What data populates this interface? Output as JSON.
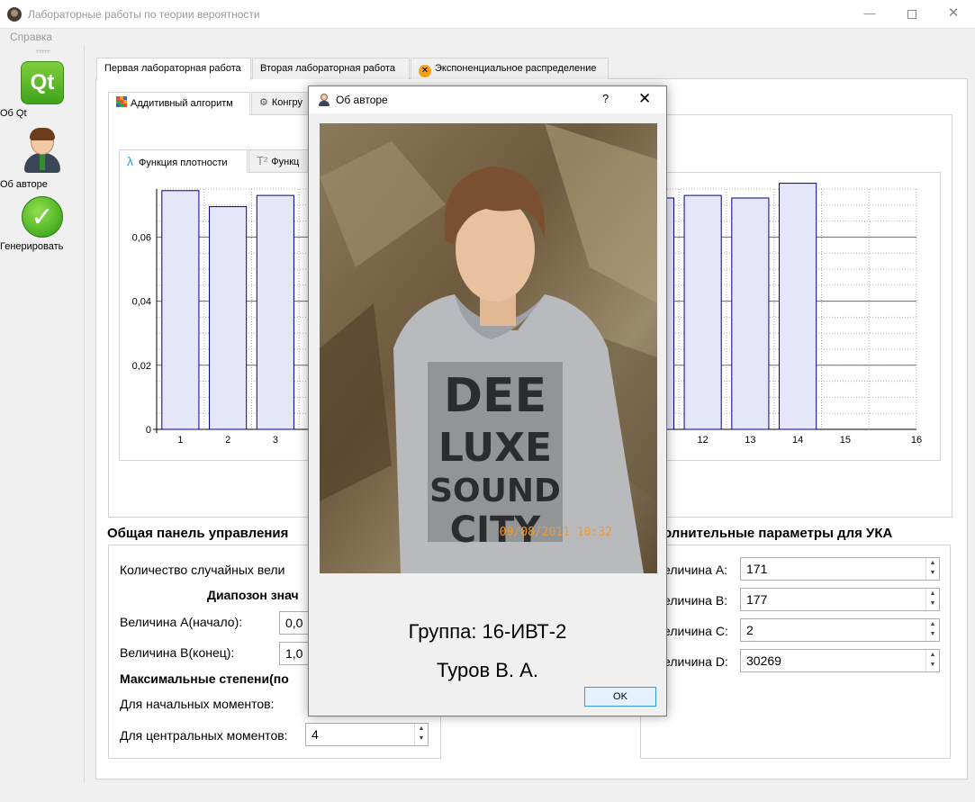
{
  "window": {
    "title": "Лабораторные работы по теории вероятности",
    "minimize": "—",
    "close": "✕"
  },
  "menu": {
    "help": "Справка"
  },
  "toolbar": {
    "about_qt": "Об Qt",
    "about_author": "Об авторе",
    "generate": "Генерировать",
    "qt_logo": "Qt"
  },
  "tabs": {
    "main": [
      {
        "label": "Первая лабораторная работа"
      },
      {
        "label": "Вторая лабораторная работа"
      },
      {
        "label": "Экспоненциальное распределение"
      }
    ],
    "sub": [
      {
        "label": "Аддитивный алгоритм"
      },
      {
        "label": "Конгру"
      }
    ],
    "chart": [
      {
        "label": "Функция плотности"
      },
      {
        "label": "Функц"
      }
    ]
  },
  "chart_data": {
    "type": "bar",
    "xlim": [
      0,
      16
    ],
    "ylim": [
      0,
      0.075
    ],
    "y_ticks": [
      "0",
      "0,02",
      "0,04",
      "0,06"
    ],
    "x_ticks": [
      "1",
      "2",
      "3",
      "11",
      "12",
      "13",
      "14",
      "15",
      "16"
    ],
    "bars_visible": [
      {
        "x": 1,
        "value": 0.0745
      },
      {
        "x": 2,
        "value": 0.0695
      },
      {
        "x": 3,
        "value": 0.073
      },
      {
        "x": 11,
        "value": 0.0722
      },
      {
        "x": 12,
        "value": 0.073
      },
      {
        "x": 13,
        "value": 0.0722
      },
      {
        "x": 14,
        "value": 0.0768
      }
    ],
    "grid": true,
    "bar_fill": "#e6e6fa",
    "bar_stroke": "#00008b"
  },
  "left_panel": {
    "title": "Общая панель управления",
    "count_label": "Количество случайных вели",
    "range_label": "Диапозон знач",
    "a_label": "Величина А(начало):",
    "a_value": "0,0",
    "b_label": "Величина В(конец):",
    "b_value": "1,0",
    "max_deg_label": "Максимальные степени(по",
    "initial_moments_label": "Для начальных моментов:",
    "central_moments_label": "Для центральных моментов:",
    "central_moments_value": "4"
  },
  "right_panel": {
    "title": "олнительные параметры для УКА",
    "a_label": "еличина А:",
    "a_value": "171",
    "b_label": "еличина В:",
    "b_value": "177",
    "c_label": "еличина С:",
    "c_value": "2",
    "d_label": "еличина D:",
    "d_value": "30269"
  },
  "dialog": {
    "title": "Об авторе",
    "help": "?",
    "close": "✕",
    "photo_timestamp": "09/08/2011 10:32",
    "shirt_text": "DEE LUXE SOUND CITY",
    "group": "Группа: 16-ИВТ-2",
    "name": "Туров В. А.",
    "ok": "OK"
  }
}
